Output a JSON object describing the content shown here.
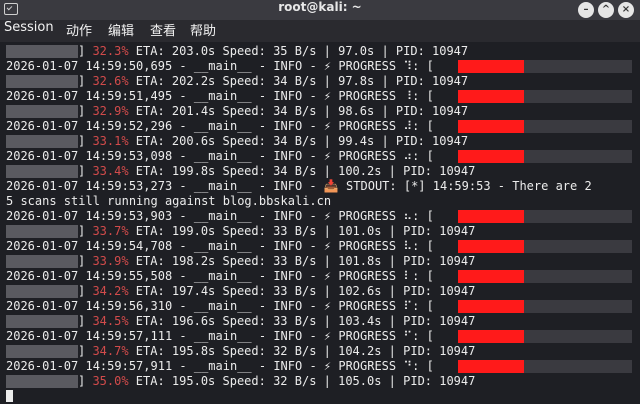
{
  "window": {
    "title": "root@kali: ~"
  },
  "window_buttons": [
    "minimize-icon",
    "maximize-icon",
    "close-icon"
  ],
  "menu": [
    "Session",
    "动作",
    "编辑",
    "查看",
    "帮助"
  ],
  "icons": {
    "progress": "lightning-icon",
    "stdout": "inbox-icon"
  },
  "lines": [
    {
      "kind": "pr",
      "pct": "32.3%",
      "rest": " ETA: 203.0s Speed: 35 B/s | 97.0s | PID: 10947"
    },
    {
      "kind": "log",
      "ts": "2026-01-07 14:59:50,695",
      "msg": " - __main__ - INFO - ⚡ PROGRESS ⠹: ["
    },
    {
      "kind": "pr",
      "pct": "32.6%",
      "rest": " ETA: 202.2s Speed: 34 B/s | 97.8s | PID: 10947"
    },
    {
      "kind": "log",
      "ts": "2026-01-07 14:59:51,495",
      "msg": " - __main__ - INFO - ⚡ PROGRESS ⠸: ["
    },
    {
      "kind": "pr",
      "pct": "32.9%",
      "rest": " ETA: 201.4s Speed: 34 B/s | 98.6s | PID: 10947"
    },
    {
      "kind": "log",
      "ts": "2026-01-07 14:59:52,296",
      "msg": " - __main__ - INFO - ⚡ PROGRESS ⠼: ["
    },
    {
      "kind": "pr",
      "pct": "33.1%",
      "rest": " ETA: 200.6s Speed: 34 B/s | 99.4s | PID: 10947"
    },
    {
      "kind": "log",
      "ts": "2026-01-07 14:59:53,098",
      "msg": " - __main__ - INFO - ⚡ PROGRESS ⠴: ["
    },
    {
      "kind": "pr",
      "pct": "33.4%",
      "rest": " ETA: 199.8s Speed: 34 B/s | 100.2s | PID: 10947"
    },
    {
      "kind": "text",
      "text": "2026-01-07 14:59:53,273 - __main__ - INFO - 📥 STDOUT: [*] 14:59:53 - There are 2"
    },
    {
      "kind": "text",
      "text": "5 scans still running against blog.bbskali.cn"
    },
    {
      "kind": "log",
      "ts": "2026-01-07 14:59:53,903",
      "msg": " - __main__ - INFO - ⚡ PROGRESS ⠦: ["
    },
    {
      "kind": "pr",
      "pct": "33.7%",
      "rest": " ETA: 199.0s Speed: 33 B/s | 101.0s | PID: 10947"
    },
    {
      "kind": "log",
      "ts": "2026-01-07 14:59:54,708",
      "msg": " - __main__ - INFO - ⚡ PROGRESS ⠧: ["
    },
    {
      "kind": "pr",
      "pct": "33.9%",
      "rest": " ETA: 198.2s Speed: 33 B/s | 101.8s | PID: 10947"
    },
    {
      "kind": "log",
      "ts": "2026-01-07 14:59:55,508",
      "msg": " - __main__ - INFO - ⚡ PROGRESS ⠇: ["
    },
    {
      "kind": "pr",
      "pct": "34.2%",
      "rest": " ETA: 197.4s Speed: 33 B/s | 102.6s | PID: 10947"
    },
    {
      "kind": "log",
      "ts": "2026-01-07 14:59:56,310",
      "msg": " - __main__ - INFO - ⚡ PROGRESS ⠏: ["
    },
    {
      "kind": "pr",
      "pct": "34.5%",
      "rest": " ETA: 196.6s Speed: 33 B/s | 103.4s | PID: 10947"
    },
    {
      "kind": "log",
      "ts": "2026-01-07 14:59:57,111",
      "msg": " - __main__ - INFO - ⚡ PROGRESS ⠋: ["
    },
    {
      "kind": "pr",
      "pct": "34.7%",
      "rest": " ETA: 195.8s Speed: 32 B/s | 104.2s | PID: 10947"
    },
    {
      "kind": "log",
      "ts": "2026-01-07 14:59:57,911",
      "msg": " - __main__ - INFO - ⚡ PROGRESS ⠙: ["
    },
    {
      "kind": "pr",
      "pct": "35.0%",
      "rest": " ETA: 195.0s Speed: 32 B/s | 105.0s | PID: 10947"
    }
  ]
}
